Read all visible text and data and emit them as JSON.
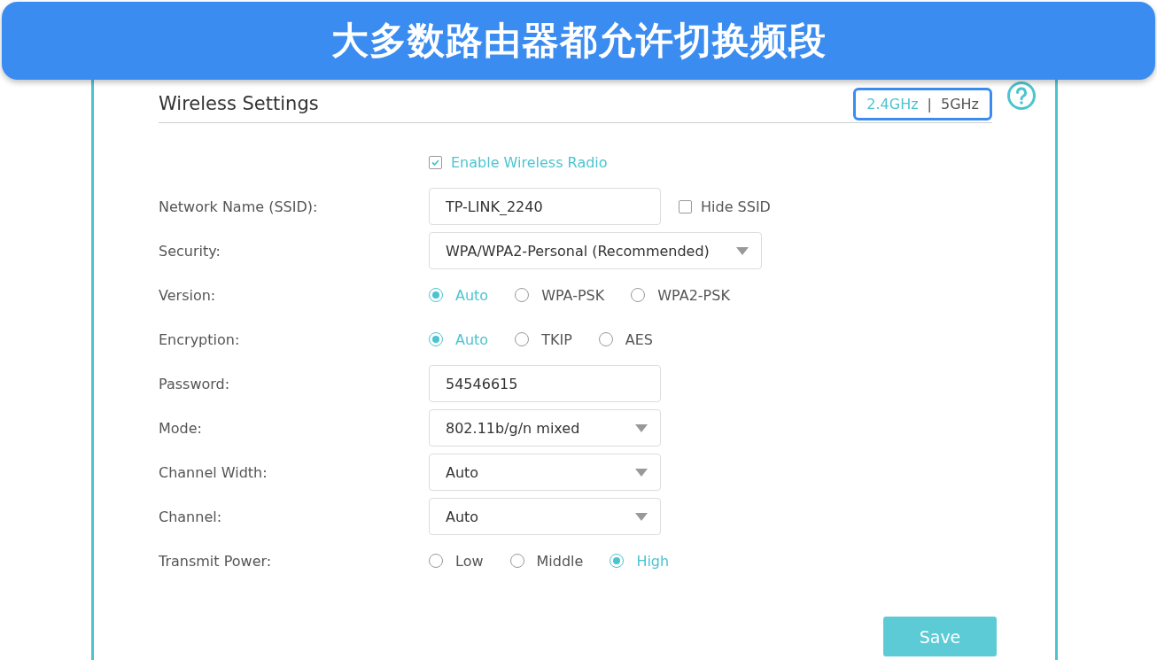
{
  "banner": {
    "text": "大多数路由器都允许切换频段"
  },
  "panel": {
    "title": "Wireless Settings",
    "separator": "|",
    "bands": [
      {
        "label": "2.4GHz",
        "selected": true
      },
      {
        "label": "5GHz",
        "selected": false
      }
    ]
  },
  "enable_wireless": {
    "label": "Enable Wireless Radio",
    "checked": true
  },
  "fields": [
    {
      "kind": "text",
      "label": "Network Name (SSID):",
      "value": "TP-LINK_2240",
      "checkbox": {
        "label": "Hide SSID",
        "checked": false
      }
    },
    {
      "kind": "select",
      "label": "Security:",
      "value": "WPA/WPA2-Personal (Recommended)"
    },
    {
      "kind": "radio",
      "label": "Version:",
      "options": [
        {
          "label": "Auto",
          "selected": true
        },
        {
          "label": "WPA-PSK",
          "selected": false
        },
        {
          "label": "WPA2-PSK",
          "selected": false
        }
      ]
    },
    {
      "kind": "radio",
      "label": "Encryption:",
      "options": [
        {
          "label": "Auto",
          "selected": true
        },
        {
          "label": "TKIP",
          "selected": false
        },
        {
          "label": "AES",
          "selected": false
        }
      ]
    },
    {
      "kind": "text",
      "label": "Password:",
      "value": "54546615"
    },
    {
      "kind": "select",
      "label": "Mode:",
      "value": "802.11b/g/n mixed"
    },
    {
      "kind": "select",
      "label": "Channel Width:",
      "value": "Auto"
    },
    {
      "kind": "select",
      "label": "Channel:",
      "value": "Auto"
    },
    {
      "kind": "radio",
      "label": "Transmit Power:",
      "options": [
        {
          "label": "Low",
          "selected": false
        },
        {
          "label": "Middle",
          "selected": false
        },
        {
          "label": "High",
          "selected": true
        }
      ]
    }
  ],
  "save_button": "Save"
}
